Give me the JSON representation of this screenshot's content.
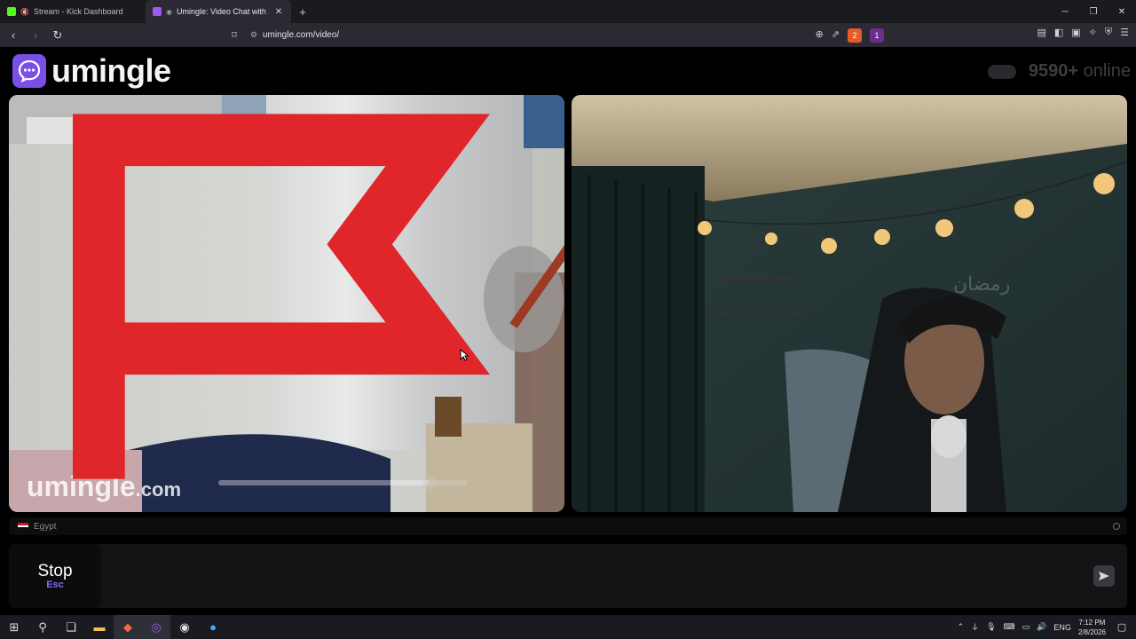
{
  "browser": {
    "tabs": [
      {
        "title": "Stream - Kick Dashboard",
        "favicon_color": "#53fc18",
        "active": false
      },
      {
        "title": "Umingle: Video Chat with Strangers",
        "favicon_color": "#9b59f6",
        "active": true
      }
    ],
    "new_tab_icon": "plus-icon",
    "url": "umingle.com/video/",
    "extension_badges": {
      "brave": "2",
      "red": "1"
    }
  },
  "site": {
    "logo_text": "umingle",
    "brand_color": "#7b4ee8",
    "online_count": "9590+",
    "online_label": "online"
  },
  "videos": {
    "left": {
      "watermark": "umingle",
      "watermark_suffix": ".com",
      "volume_level": 0.85
    },
    "right": {
      "wall_text": "رمضان"
    }
  },
  "country": {
    "name": "Egypt"
  },
  "chat": {
    "stop_label": "Stop",
    "stop_key": "Esc",
    "input_placeholder": "",
    "accent_color": "#7b6cff"
  },
  "taskbar": {
    "language": "ENG",
    "time": "7:12 PM",
    "date": "2/8/2026"
  }
}
